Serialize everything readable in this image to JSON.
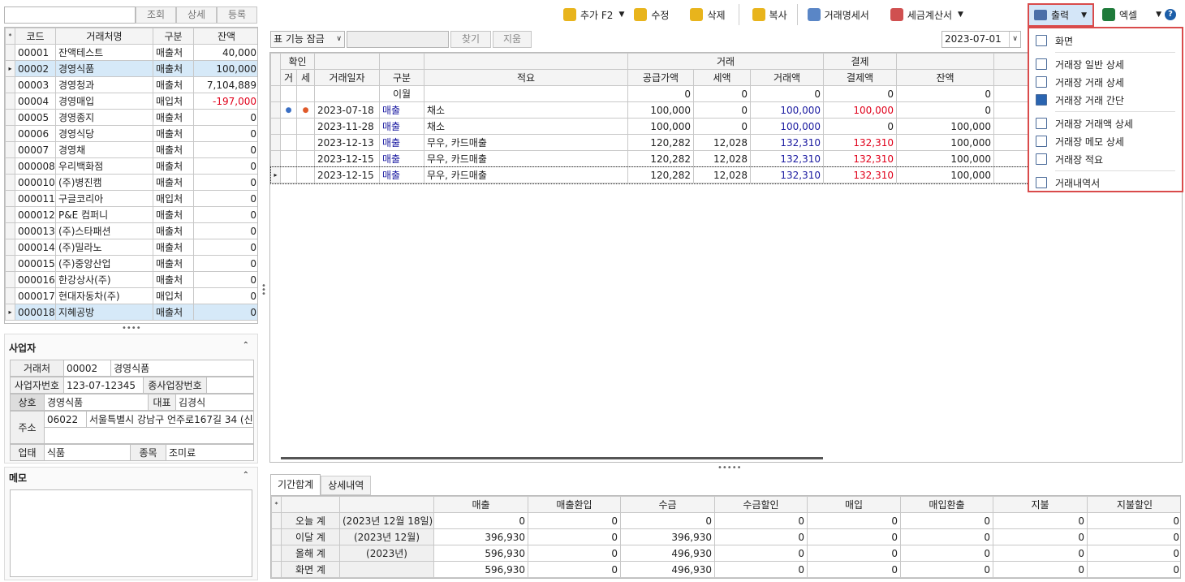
{
  "left_search": {
    "placeholder": "",
    "buttons": [
      "조회",
      "상세",
      "등록"
    ]
  },
  "client_table": {
    "headers": [
      "코드",
      "거래처명",
      "구분",
      "잔액"
    ],
    "rows": [
      [
        "00001",
        "잔액테스트",
        "매출처",
        "40,000"
      ],
      [
        "00002",
        "경영식품",
        "매출처",
        "100,000"
      ],
      [
        "00003",
        "경영청과",
        "매출처",
        "7,104,889"
      ],
      [
        "00004",
        "경영매입",
        "매입처",
        "-197,000"
      ],
      [
        "00005",
        "경영종지",
        "매출처",
        "0"
      ],
      [
        "00006",
        "경영식당",
        "매출처",
        "0"
      ],
      [
        "00007",
        "경영채",
        "매출처",
        "0"
      ],
      [
        "000008",
        "우리백화점",
        "매출처",
        "0"
      ],
      [
        "000010",
        "(주)병진캠",
        "매출처",
        "0"
      ],
      [
        "000011",
        "구글코리아",
        "매입처",
        "0"
      ],
      [
        "000012",
        "P&E 컴퍼니",
        "매출처",
        "0"
      ],
      [
        "000013",
        "(주)스타패션",
        "매출처",
        "0"
      ],
      [
        "000014",
        "(주)밀라노",
        "매출처",
        "0"
      ],
      [
        "000015",
        "(주)중앙산업",
        "매출처",
        "0"
      ],
      [
        "000016",
        "한강상사(주)",
        "매출처",
        "0"
      ],
      [
        "000017",
        "현대자동차(주)",
        "매입처",
        "0"
      ],
      [
        "000018",
        "지혜공방",
        "매출처",
        "0"
      ]
    ]
  },
  "business": {
    "title": "사업자",
    "client_label": "거래처",
    "client_code": "00002",
    "client_name": "경영식품",
    "biz_no_label": "사업자번호",
    "biz_no": "123-07-12345",
    "sub_label": "종사업장번호",
    "sub_value": "",
    "trade_label": "상호",
    "trade": "경영식품",
    "rep_label": "대표",
    "rep": "김경식",
    "addr_label": "주소",
    "zip": "06022",
    "addr": "서울특별시 강남구 언주로167길 34 (신",
    "type_label": "업태",
    "type": "식품",
    "item_label": "종목",
    "item": "조미료"
  },
  "memo": {
    "title": "메모"
  },
  "toolbar": {
    "add": "추가 F2",
    "edit": "수정",
    "delete": "삭제",
    "copy": "복사",
    "statement": "거래명세서",
    "tax": "세금계산서",
    "print": "출력",
    "excel": "엑셀",
    "help": "?"
  },
  "filter": {
    "lock": "표 기능 잠금",
    "find": "찾기",
    "clear": "지움",
    "date": "2023-07-01"
  },
  "ledger": {
    "group_confirm": "확인",
    "group_trade": "거래",
    "group_pay": "결제",
    "headers": [
      "거",
      "세",
      "거래일자",
      "구분",
      "적요",
      "공급가액",
      "세액",
      "거래액",
      "결제액",
      "잔액"
    ],
    "carry_label": "이월",
    "carry_values": [
      "0",
      "0",
      "0",
      "0",
      "0"
    ],
    "rows": [
      {
        "d1": "●",
        "d2": "●",
        "date": "2023-07-18",
        "kind": "매출",
        "memo": "채소",
        "supply": "100,000",
        "tax": "0",
        "amount": "100,000",
        "pay": "100,000",
        "bal": "0"
      },
      {
        "d1": "",
        "d2": "",
        "date": "2023-11-28",
        "kind": "매출",
        "memo": "채소",
        "supply": "100,000",
        "tax": "0",
        "amount": "100,000",
        "pay": "0",
        "bal": "100,000"
      },
      {
        "d1": "",
        "d2": "",
        "date": "2023-12-13",
        "kind": "매출",
        "memo": "무우, 카드매출",
        "supply": "120,282",
        "tax": "12,028",
        "amount": "132,310",
        "pay": "132,310",
        "bal": "100,000"
      },
      {
        "d1": "",
        "d2": "",
        "date": "2023-12-15",
        "kind": "매출",
        "memo": "무우, 카드매출",
        "supply": "120,282",
        "tax": "12,028",
        "amount": "132,310",
        "pay": "132,310",
        "bal": "100,000"
      },
      {
        "d1": "",
        "d2": "",
        "date": "2023-12-15",
        "kind": "매출",
        "memo": "무우, 카드매출",
        "supply": "120,282",
        "tax": "12,028",
        "amount": "132,310",
        "pay": "132,310",
        "bal": "100,000"
      }
    ]
  },
  "print_menu": {
    "items": [
      "화면",
      "거래장 일반 상세",
      "거래장 거래 상세",
      "거래장 거래 간단",
      "거래장 거래액 상세",
      "거래장 메모 상세",
      "거래장 적요",
      "거래내역서"
    ]
  },
  "tabs": [
    "기간합계",
    "상세내역"
  ],
  "summary": {
    "headers": [
      "매출",
      "매출환입",
      "수금",
      "수금할인",
      "매입",
      "매입환출",
      "지불",
      "지불할인"
    ],
    "rows": [
      {
        "label": "오늘 계",
        "period": "(2023년 12월 18일)",
        "vals": [
          "0",
          "0",
          "0",
          "0",
          "0",
          "0",
          "0",
          "0"
        ]
      },
      {
        "label": "이달 계",
        "period": "(2023년 12월)",
        "vals": [
          "396,930",
          "0",
          "396,930",
          "0",
          "0",
          "0",
          "0",
          "0"
        ]
      },
      {
        "label": "올해 계",
        "period": "(2023년)",
        "vals": [
          "596,930",
          "0",
          "496,930",
          "0",
          "0",
          "0",
          "0",
          "0"
        ]
      },
      {
        "label": "화면 계",
        "period": "",
        "vals": [
          "596,930",
          "0",
          "496,930",
          "0",
          "0",
          "0",
          "0",
          "0"
        ]
      }
    ]
  },
  "colors": {
    "highlight": "#d94b4b",
    "selected_row": "#d6e9f8",
    "red_text": "#e0001a",
    "blue_text": "#1a1aa0"
  }
}
